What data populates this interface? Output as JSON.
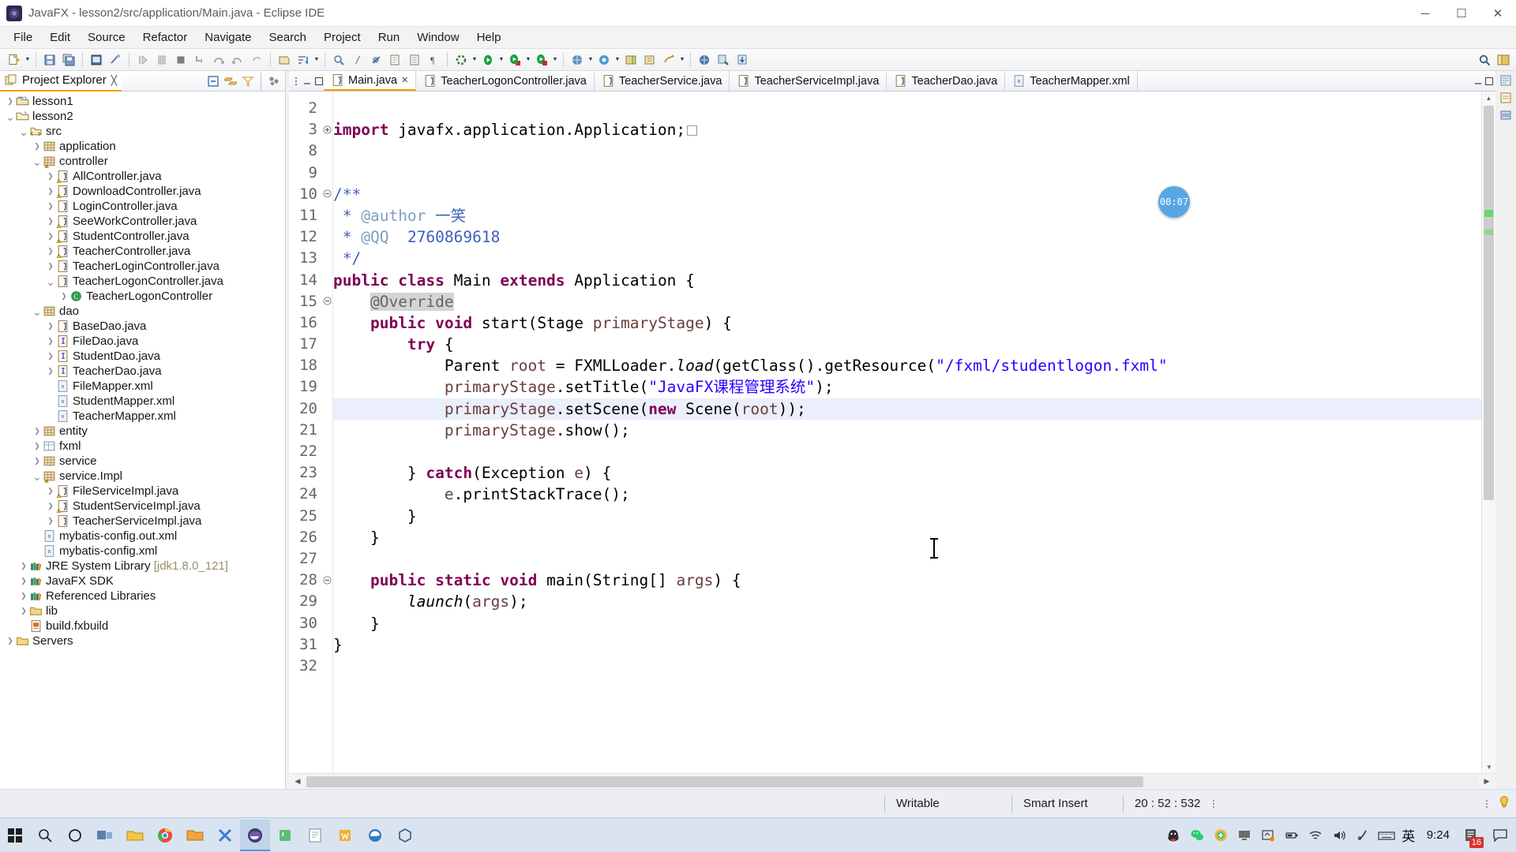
{
  "window": {
    "title": "JavaFX - lesson2/src/application/Main.java - Eclipse IDE",
    "app_icon": "eclipse-icon",
    "minimize": "─",
    "maximize": "☐",
    "close": "✕"
  },
  "menubar": {
    "items": [
      "File",
      "Edit",
      "Source",
      "Refactor",
      "Navigate",
      "Search",
      "Project",
      "Run",
      "Window",
      "Help"
    ]
  },
  "explorer": {
    "tab_label": "Project Explorer",
    "tab_close": "╳",
    "tools": [
      "collapse-all-icon",
      "link-with-editor-icon",
      "view-menu-filter-icon",
      "focus-on-active-task-icon"
    ],
    "tree": [
      {
        "indent": 0,
        "twisty": "collapsed",
        "icon": "project-closed",
        "label": "lesson1"
      },
      {
        "indent": 0,
        "twisty": "expanded",
        "icon": "project-open",
        "label": "lesson2"
      },
      {
        "indent": 1,
        "twisty": "expanded",
        "icon": "source-folder",
        "label": "src"
      },
      {
        "indent": 2,
        "twisty": "collapsed",
        "icon": "package",
        "label": "application"
      },
      {
        "indent": 2,
        "twisty": "expanded",
        "icon": "package-warn",
        "label": "controller"
      },
      {
        "indent": 3,
        "twisty": "collapsed",
        "icon": "java-warn",
        "label": "AllController.java"
      },
      {
        "indent": 3,
        "twisty": "collapsed",
        "icon": "java-warn",
        "label": "DownloadController.java"
      },
      {
        "indent": 3,
        "twisty": "collapsed",
        "icon": "java",
        "label": "LoginController.java"
      },
      {
        "indent": 3,
        "twisty": "collapsed",
        "icon": "java-warn",
        "label": "SeeWorkController.java"
      },
      {
        "indent": 3,
        "twisty": "collapsed",
        "icon": "java-warn",
        "label": "StudentController.java"
      },
      {
        "indent": 3,
        "twisty": "collapsed",
        "icon": "java-warn",
        "label": "TeacherController.java"
      },
      {
        "indent": 3,
        "twisty": "collapsed",
        "icon": "java",
        "label": "TeacherLoginController.java"
      },
      {
        "indent": 3,
        "twisty": "expanded",
        "icon": "java",
        "label": "TeacherLogonController.java"
      },
      {
        "indent": 4,
        "twisty": "collapsed",
        "icon": "class",
        "label": "TeacherLogonController"
      },
      {
        "indent": 2,
        "twisty": "expanded",
        "icon": "package",
        "label": "dao"
      },
      {
        "indent": 3,
        "twisty": "collapsed",
        "icon": "java",
        "label": "BaseDao.java"
      },
      {
        "indent": 3,
        "twisty": "collapsed",
        "icon": "interface",
        "label": "FileDao.java"
      },
      {
        "indent": 3,
        "twisty": "collapsed",
        "icon": "interface",
        "label": "StudentDao.java"
      },
      {
        "indent": 3,
        "twisty": "collapsed",
        "icon": "interface",
        "label": "TeacherDao.java"
      },
      {
        "indent": 3,
        "twisty": "none",
        "icon": "xml",
        "label": "FileMapper.xml"
      },
      {
        "indent": 3,
        "twisty": "none",
        "icon": "xml",
        "label": "StudentMapper.xml"
      },
      {
        "indent": 3,
        "twisty": "none",
        "icon": "xml",
        "label": "TeacherMapper.xml"
      },
      {
        "indent": 2,
        "twisty": "collapsed",
        "icon": "package",
        "label": "entity"
      },
      {
        "indent": 2,
        "twisty": "collapsed",
        "icon": "fxml-package",
        "label": "fxml"
      },
      {
        "indent": 2,
        "twisty": "collapsed",
        "icon": "package",
        "label": "service"
      },
      {
        "indent": 2,
        "twisty": "expanded",
        "icon": "package-warn",
        "label": "service.Impl"
      },
      {
        "indent": 3,
        "twisty": "collapsed",
        "icon": "java-warn",
        "label": "FileServiceImpl.java"
      },
      {
        "indent": 3,
        "twisty": "collapsed",
        "icon": "java-warn",
        "label": "StudentServiceImpl.java"
      },
      {
        "indent": 3,
        "twisty": "collapsed",
        "icon": "java",
        "label": "TeacherServiceImpl.java"
      },
      {
        "indent": 2,
        "twisty": "none",
        "icon": "xml",
        "label": "mybatis-config.out.xml"
      },
      {
        "indent": 2,
        "twisty": "none",
        "icon": "xml",
        "label": "mybatis-config.xml"
      },
      {
        "indent": 1,
        "twisty": "collapsed",
        "icon": "library",
        "label": "JRE System Library ",
        "suffix": "[jdk1.8.0_121]"
      },
      {
        "indent": 1,
        "twisty": "collapsed",
        "icon": "library",
        "label": "JavaFX SDK"
      },
      {
        "indent": 1,
        "twisty": "collapsed",
        "icon": "library",
        "label": "Referenced Libraries"
      },
      {
        "indent": 1,
        "twisty": "collapsed",
        "icon": "folder",
        "label": "lib"
      },
      {
        "indent": 1,
        "twisty": "none",
        "icon": "fxbuild",
        "label": "build.fxbuild"
      },
      {
        "indent": 0,
        "twisty": "collapsed",
        "icon": "folder",
        "label": "Servers"
      }
    ]
  },
  "editor": {
    "tabs": [
      {
        "label": "Main.java",
        "icon": "java",
        "active": true,
        "closeable": true
      },
      {
        "label": "TeacherLogonController.java",
        "icon": "java",
        "active": false,
        "closeable": false
      },
      {
        "label": "TeacherService.java",
        "icon": "java",
        "active": false,
        "closeable": false
      },
      {
        "label": "TeacherServiceImpl.java",
        "icon": "java",
        "active": false,
        "closeable": false
      },
      {
        "label": "TeacherDao.java",
        "icon": "java",
        "active": false,
        "closeable": false
      },
      {
        "label": "TeacherMapper.xml",
        "icon": "xml",
        "active": false,
        "closeable": false
      }
    ],
    "first_visible_line": 2,
    "lines": [
      {
        "n": 2,
        "fold": "",
        "html": "",
        "hl": false
      },
      {
        "n": 3,
        "fold": "+",
        "html": "<span class=\"k\">import</span> javafx.application.Application;<span class=\"collapse-box\"></span>",
        "hl": false
      },
      {
        "n": 8,
        "fold": "",
        "html": "",
        "hl": false
      },
      {
        "n": 9,
        "fold": "",
        "html": "",
        "hl": false
      },
      {
        "n": 10,
        "fold": "-",
        "html": "<span class=\"c\">/**</span>",
        "hl": false
      },
      {
        "n": 11,
        "fold": "",
        "html": "<span class=\"c\"> * </span><span class=\"ct\">@author</span><span class=\"c\"> 一笑</span>",
        "hl": false
      },
      {
        "n": 12,
        "fold": "",
        "html": "<span class=\"c\"> * </span><span class=\"ct\">@QQ</span><span class=\"c\">  2760869618</span>",
        "hl": false
      },
      {
        "n": 13,
        "fold": "",
        "html": "<span class=\"c\"> */</span>",
        "hl": false
      },
      {
        "n": 14,
        "fold": "",
        "html": "<span class=\"k\">public</span> <span class=\"k\">class</span> Main <span class=\"k\">extends</span> Application {",
        "hl": false
      },
      {
        "n": 15,
        "fold": "-",
        "html": "    <span class=\"ann\">@Override</span>",
        "hl": false
      },
      {
        "n": 16,
        "fold": "",
        "html": "    <span class=\"k\">public</span> <span class=\"k\">void</span> start(Stage <span class=\"f\">primaryStage</span>) {",
        "hl": false
      },
      {
        "n": 17,
        "fold": "",
        "html": "        <span class=\"k\">try</span> {",
        "hl": false
      },
      {
        "n": 18,
        "fold": "",
        "html": "            Parent <span class=\"f\">root</span> = FXMLLoader.<span class=\"st\">load</span>(getClass().getResource(<span class=\"s\">\"/fxml/studentlogon.fxml\"</span>",
        "hl": false
      },
      {
        "n": 19,
        "fold": "",
        "html": "            <span class=\"f\">primaryStage</span>.setTitle(<span class=\"s\">\"JavaFX课程管理系统\"</span>);",
        "hl": false
      },
      {
        "n": 20,
        "fold": "",
        "html": "            <span class=\"f\">primaryStage</span>.setScene(<span class=\"k\">new</span> Scene(<span class=\"f\">root</span>));",
        "hl": true
      },
      {
        "n": 21,
        "fold": "",
        "html": "            <span class=\"f\">primaryStage</span>.show();",
        "hl": false
      },
      {
        "n": 22,
        "fold": "",
        "html": "",
        "hl": false
      },
      {
        "n": 23,
        "fold": "",
        "html": "        } <span class=\"k\">catch</span>(Exception <span class=\"f\">e</span>) {",
        "hl": false
      },
      {
        "n": 24,
        "fold": "",
        "html": "            <span class=\"f\">e</span>.printStackTrace();",
        "hl": false
      },
      {
        "n": 25,
        "fold": "",
        "html": "        }",
        "hl": false
      },
      {
        "n": 26,
        "fold": "",
        "html": "    }",
        "hl": false
      },
      {
        "n": 27,
        "fold": "",
        "html": "",
        "hl": false
      },
      {
        "n": 28,
        "fold": "-",
        "html": "    <span class=\"k\">public</span> <span class=\"k\">static</span> <span class=\"k\">void</span> main(String[] <span class=\"f\">args</span>) {",
        "hl": false
      },
      {
        "n": 29,
        "fold": "",
        "html": "        <span class=\"st\">launch</span>(<span class=\"f\">args</span>);",
        "hl": false
      },
      {
        "n": 30,
        "fold": "",
        "html": "    }",
        "hl": false
      },
      {
        "n": 31,
        "fold": "",
        "html": "}",
        "hl": false
      },
      {
        "n": 32,
        "fold": "",
        "html": "",
        "hl": false
      }
    ]
  },
  "overlay": {
    "recorder_timer": "00:07"
  },
  "statusbar": {
    "writable": "Writable",
    "insert_mode": "Smart Insert",
    "position": "20 : 52 : 532",
    "tip_icon": "lightbulb-icon"
  },
  "taskbar": {
    "start": "windows-start-icon",
    "buttons": [
      "search-icon",
      "cortana-icon",
      "task-view-icon",
      "explorer-icon",
      "chrome-icon",
      "folder-icon",
      "x-app-icon",
      "eclipse-icon",
      "java-icon",
      "notepad-icon",
      "word-icon",
      "edge-icon",
      "box-icon"
    ],
    "tray": [
      "qq-icon",
      "wechat-icon",
      "antivirus-icon",
      "display-icon",
      "screenshot-icon",
      "battery-icon",
      "wifi-icon",
      "volume-icon",
      "pen-icon",
      "keyboard-icon"
    ],
    "ime": "英",
    "clock": "9:24",
    "notification_count": "16",
    "action_center": "action-center-icon"
  },
  "colors": {
    "accent": "#ff9b00",
    "keyword": "#7f0055",
    "string": "#2a00ff",
    "javadoc": "#3f5fbf",
    "javadoc_tag": "#7f9fbf",
    "field": "#6a3e3e",
    "highlight_line": "#eaeffb",
    "bubble": "#4fa3e3",
    "badge": "#d9342b"
  },
  "toolbar": {
    "groups": [
      [
        "new-wizard",
        "save",
        "save-all",
        "java-project",
        "run-last-tool"
      ],
      [
        "debug",
        "pause",
        "stop",
        "step-into",
        "step-over",
        "step-return",
        "undo-step",
        "redo-step"
      ],
      [
        "open-type",
        "open-task",
        "search-ref",
        "thread",
        "skip-breakpoints"
      ],
      [
        "new-java-class",
        "new-java-package",
        "pilcrow"
      ],
      [
        "external-tools",
        "run",
        "debug-as",
        "coverage"
      ],
      [
        "new-window",
        "new-editor",
        "previous-annotation",
        "next-annotation",
        "back",
        "forward"
      ],
      [
        "search",
        "perspective",
        "open-perspective"
      ]
    ]
  }
}
